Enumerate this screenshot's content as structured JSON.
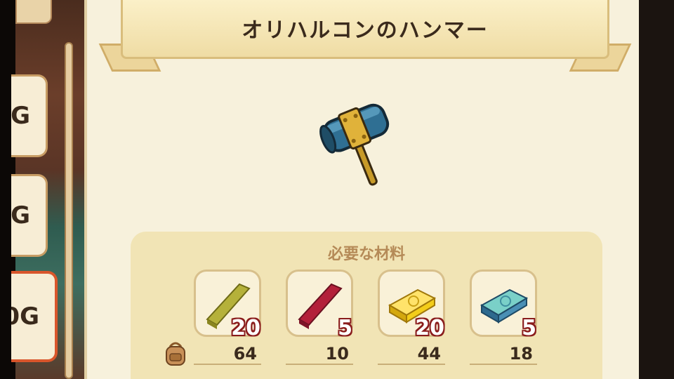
{
  "item": {
    "title": "オリハルコンのハンマー",
    "icon": "orichalcum-hammer-icon"
  },
  "sidebar": {
    "prices": [
      {
        "label": "G",
        "selected": false
      },
      {
        "label": "G",
        "selected": false
      },
      {
        "label": "0G",
        "selected": true
      }
    ]
  },
  "materials": {
    "heading": "必要な材料",
    "items": [
      {
        "icon": "green-bar-icon",
        "color": "#b5b13a",
        "required": "20",
        "owned": "64"
      },
      {
        "icon": "red-bar-icon",
        "color": "#b3203a",
        "required": "5",
        "owned": "10"
      },
      {
        "icon": "gold-ingot-icon",
        "color": "#f3cd1a",
        "required": "20",
        "owned": "44"
      },
      {
        "icon": "blue-ingot-icon",
        "color": "#4a8fb5",
        "required": "5",
        "owned": "18"
      }
    ],
    "owned_icon": "backpack-icon"
  }
}
